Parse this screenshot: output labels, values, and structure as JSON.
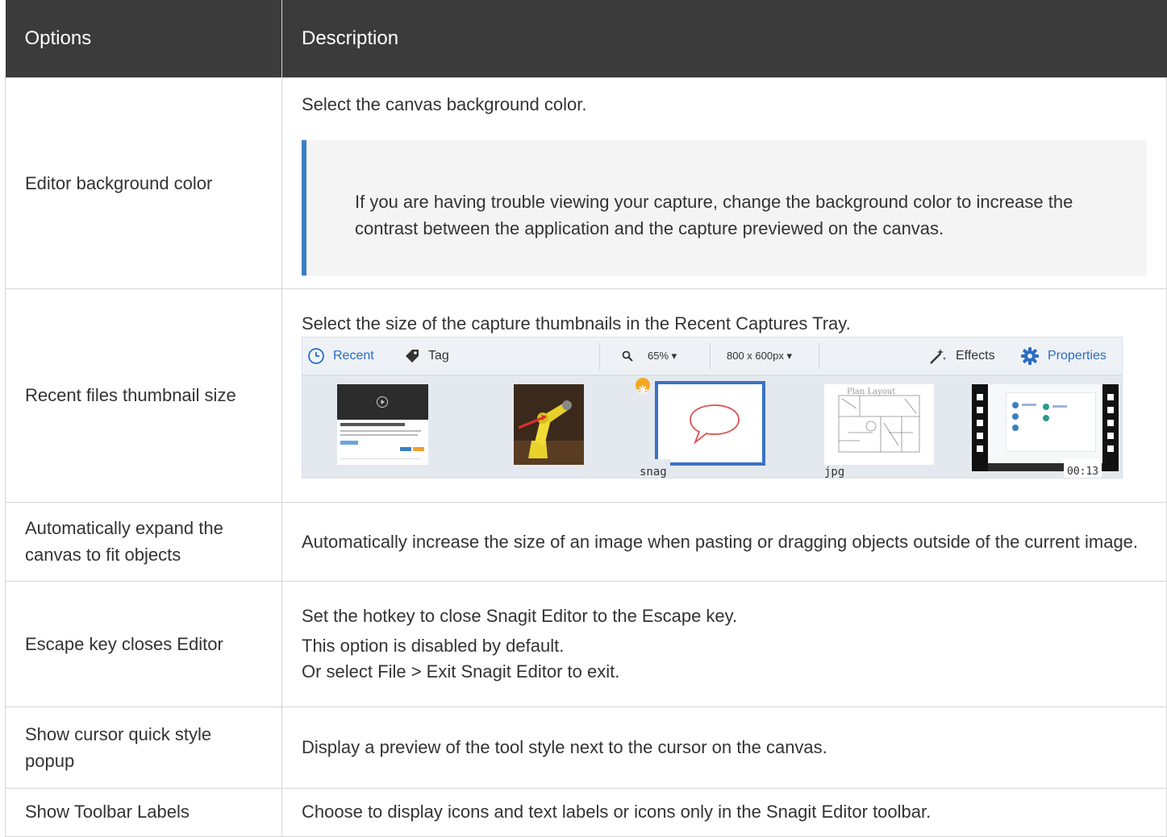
{
  "table": {
    "headers": {
      "options": "Options",
      "description": "Description"
    },
    "rows": [
      {
        "option": "Editor background color",
        "description": "Select the canvas background color.",
        "note": "If you are having trouble viewing your capture, change the background color to increase the contrast between the application and the capture previewed on the canvas."
      },
      {
        "option": "Recent files thumbnail size",
        "description": "Select the size of the capture thumbnails in the Recent Captures Tray."
      },
      {
        "option": "Automatically expand the canvas to fit objects",
        "description": "Automatically increase the size of an image when pasting or dragging objects outside of the current image."
      },
      {
        "option": "Escape key closes Editor",
        "description_lines": [
          "Set the hotkey to close Snagit Editor to the Escape key.",
          "This option is disabled by default.",
          "Or select File > Exit Snagit Editor to exit."
        ]
      },
      {
        "option": "Show cursor quick style popup",
        "description": "Display a preview of the tool style next to the cursor on the canvas."
      },
      {
        "option": "Show Toolbar Labels",
        "description": "Choose to display icons and text labels or icons only in the Snagit Editor toolbar."
      }
    ]
  },
  "tray": {
    "recent": "Recent",
    "tag": "Tag",
    "zoom": "65% ▾",
    "size": "800 x 600px ▾",
    "effects": "Effects",
    "properties": "Properties",
    "thumb_labels": {
      "snag": "snag",
      "jpg": "jpg",
      "duration": "00:13"
    },
    "accent": "#2a6cc4"
  }
}
